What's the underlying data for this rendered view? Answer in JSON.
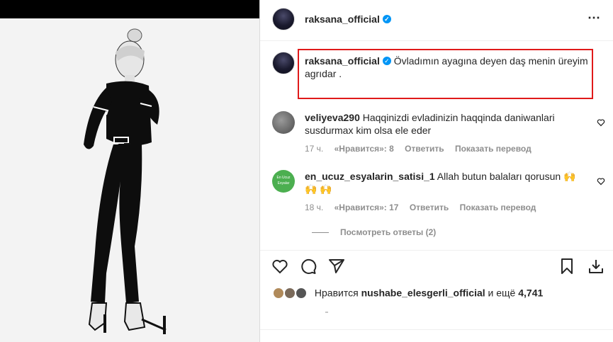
{
  "post": {
    "username": "raksana_official",
    "verified_icon": "verified-badge-icon",
    "more_icon": "more-options-icon"
  },
  "caption": {
    "username": "raksana_official",
    "text": "Övladımın ayagına deyen daş menin üreyim agrıdar ."
  },
  "comments": [
    {
      "username": "veliyeva290",
      "text": "Haqqinizdi evladinizin haqqinda daniwanlari susdurmax kim olsa ele eder",
      "time": "17 ч.",
      "likes": "«Нравится»: 8",
      "reply": "Ответить",
      "translate": "Показать перевод"
    },
    {
      "username": "en_ucuz_esyalarin_satisi_1",
      "text": "Allah butun balaları qorusun 🙌🙌 🙌",
      "time": "18 ч.",
      "likes": "«Нравится»: 17",
      "reply": "Ответить",
      "translate": "Показать перевод",
      "avatar_text": "En Ucuz Esyalar"
    }
  ],
  "view_replies": "Посмотреть ответы (2)",
  "actions": {
    "like_icon": "heart-icon",
    "comment_icon": "comment-icon",
    "share_icon": "share-icon",
    "save_icon": "bookmark-icon",
    "download_icon": "download-icon"
  },
  "likes": {
    "prefix": "Нравится",
    "user": "nushabe_elesgerli_official",
    "middle": "и ещё",
    "count": "4,741"
  },
  "colors": {
    "highlight": "#e01a1a",
    "verified": "#0095f6",
    "muted": "#8e8e8e"
  }
}
